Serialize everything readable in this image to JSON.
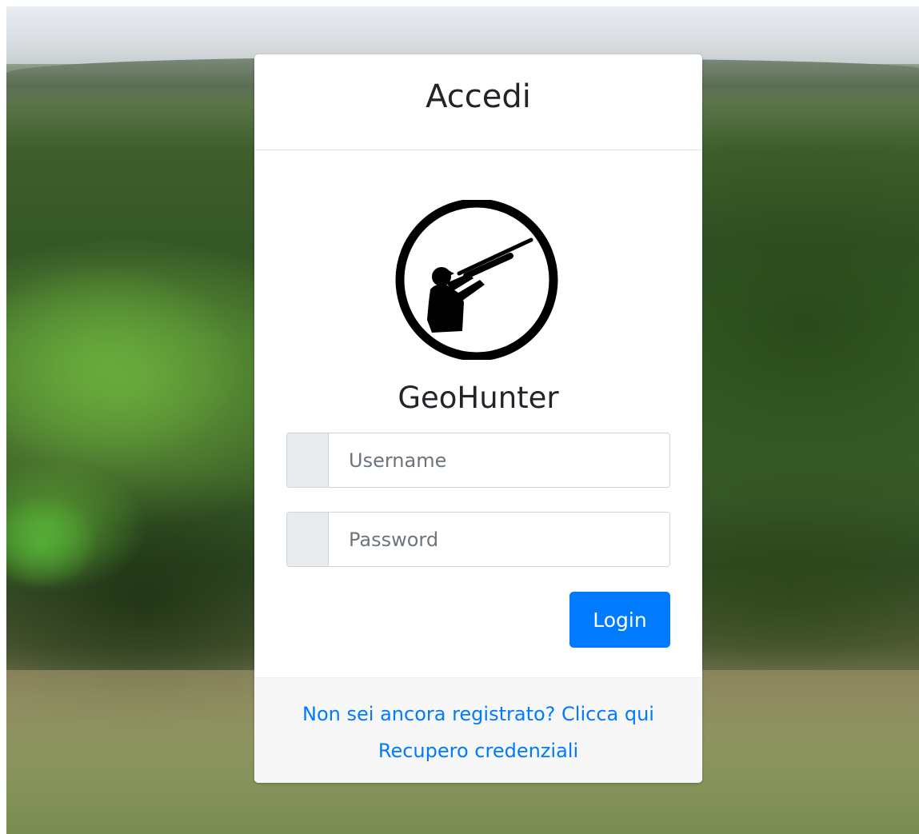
{
  "card": {
    "title": "Accedi",
    "brand_name": "GeoHunter",
    "logo_icon": "hunter-logo-icon"
  },
  "form": {
    "username_placeholder": "Username",
    "password_placeholder": "Password",
    "login_label": "Login"
  },
  "footer": {
    "register_link": "Non sei ancora registrato? Clicca qui",
    "recover_link": "Recupero credenziali"
  },
  "colors": {
    "primary": "#007bff",
    "addon_bg": "#e9ecef",
    "footer_bg": "#f7f7f7"
  }
}
